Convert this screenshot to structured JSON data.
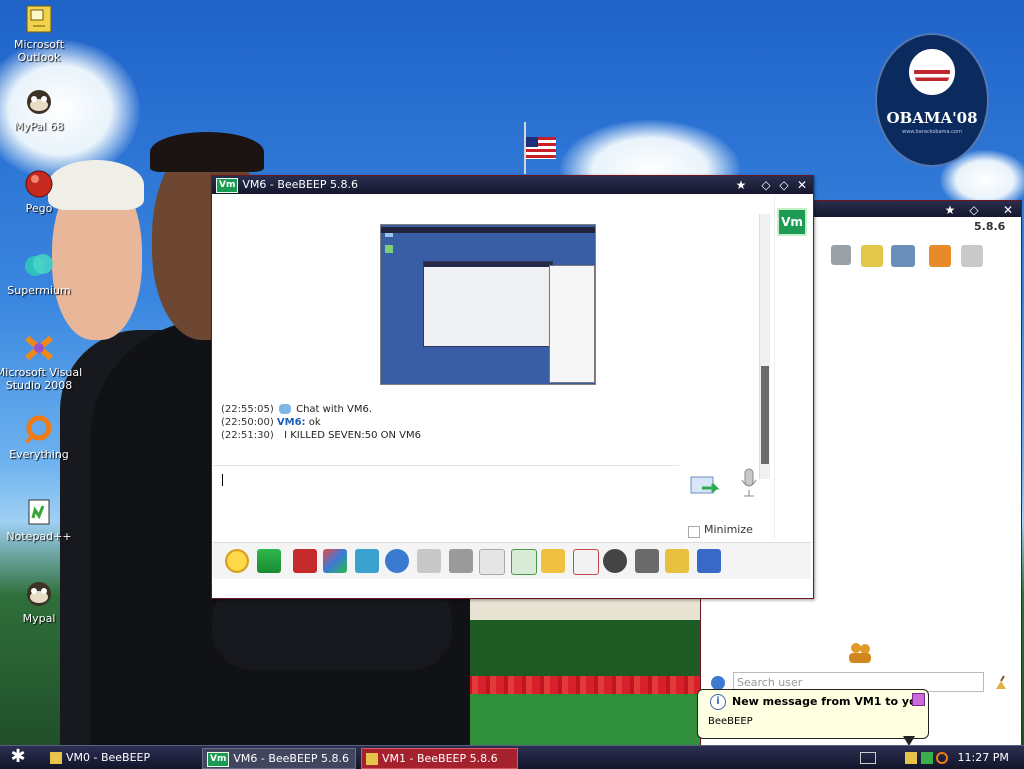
{
  "desktop_icons": [
    {
      "label": "Microsoft Outlook",
      "icon": "outlook-icon"
    },
    {
      "label": "MyPal 68",
      "icon": "mypal-icon"
    },
    {
      "label": "Pego",
      "icon": "pego-icon"
    },
    {
      "label": "Supermium",
      "icon": "supermium-icon"
    },
    {
      "label": "Microsoft Visual Studio 2008",
      "icon": "visual-studio-icon"
    },
    {
      "label": "Everything",
      "icon": "everything-icon"
    },
    {
      "label": "Notepad++",
      "icon": "notepadpp-icon"
    },
    {
      "label": "Mypal",
      "icon": "mypal-icon"
    }
  ],
  "wallpaper": {
    "logo_text": "OBAMA'08",
    "logo_subtext": "www.barackobama.com"
  },
  "chat_window": {
    "title": "VM6 - BeeBEEP 5.8.6",
    "badge": "Vm",
    "avatar": "Vm",
    "messages": [
      {
        "time": "(22:55:05)",
        "sender": "",
        "text": "Chat with VM6."
      },
      {
        "time": "(22:50:00)",
        "sender": "VM6:",
        "text": "ok"
      },
      {
        "time": "(22:51:30)",
        "sender": "",
        "text": "I KILLED SEVEN:50 ON VM6"
      }
    ],
    "minimize_label": "Minimize",
    "toolbar_icons": [
      "emoticon-icon",
      "save-icon",
      "font-icon",
      "color-icon",
      "filter-icon",
      "settings-icon",
      "spellcheck-icon",
      "font-size-icon",
      "sound-icon",
      "send-file-icon",
      "folder-send-icon",
      "html-icon",
      "screenshot-icon",
      "window-icon",
      "note-icon",
      "save-chat-icon"
    ]
  },
  "main_window": {
    "version": "5.8.6",
    "search_placeholder": "Search user"
  },
  "notification": {
    "title": "New message from VM1 to you",
    "body": "BeeBEEP"
  },
  "taskbar": {
    "items": [
      {
        "label": "VM0 - BeeBEEP",
        "state": "normal"
      },
      {
        "label": "VM6 - BeeBEEP 5.8.6",
        "state": "active"
      },
      {
        "label": "VM1 - BeeBEEP 5.8.6",
        "state": "attention"
      }
    ],
    "clock": "11:27 PM"
  }
}
